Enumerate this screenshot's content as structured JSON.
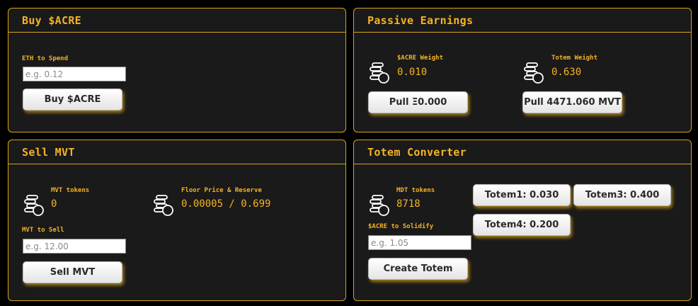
{
  "buy": {
    "title": "Buy $ACRE",
    "eth_label": "ETH to Spend",
    "eth_placeholder": "e.g. 0.12",
    "buy_button": "Buy $ACRE"
  },
  "passive": {
    "title": "Passive Earnings",
    "acre_weight_label": "$ACRE Weight",
    "acre_weight_value": "0.010",
    "totem_weight_label": "Totem Weight",
    "totem_weight_value": "0.630",
    "pull_eth_button": "Pull Ξ0.000",
    "pull_mvt_button": "Pull 4471.060 MVT"
  },
  "sell": {
    "title": "Sell MVT",
    "mvt_tokens_label": "MVT tokens",
    "mvt_tokens_value": "0",
    "floor_label": "Floor Price & Reserve",
    "floor_value": "0.00005 / 0.699",
    "mvt_sell_label": "MVT to Sell",
    "mvt_sell_placeholder": "e.g. 12.00",
    "sell_button": "Sell MVT"
  },
  "totem": {
    "title": "Totem Converter",
    "mdt_tokens_label": "MDT tokens",
    "mdt_tokens_value": "8718",
    "solidify_label": "$ACRE to Solidify",
    "solidify_placeholder": "e.g. 1.05",
    "create_button": "Create Totem",
    "totem_buttons": [
      "Totem1: 0.030",
      "Totem3: 0.400",
      "Totem4: 0.200"
    ]
  },
  "icons": {
    "coin_stack": "coin-stack-icon"
  },
  "colors": {
    "accent": "#f5b325",
    "border": "#d9a31a",
    "panel_bg": "#1a1a1a",
    "page_bg": "#000000"
  }
}
